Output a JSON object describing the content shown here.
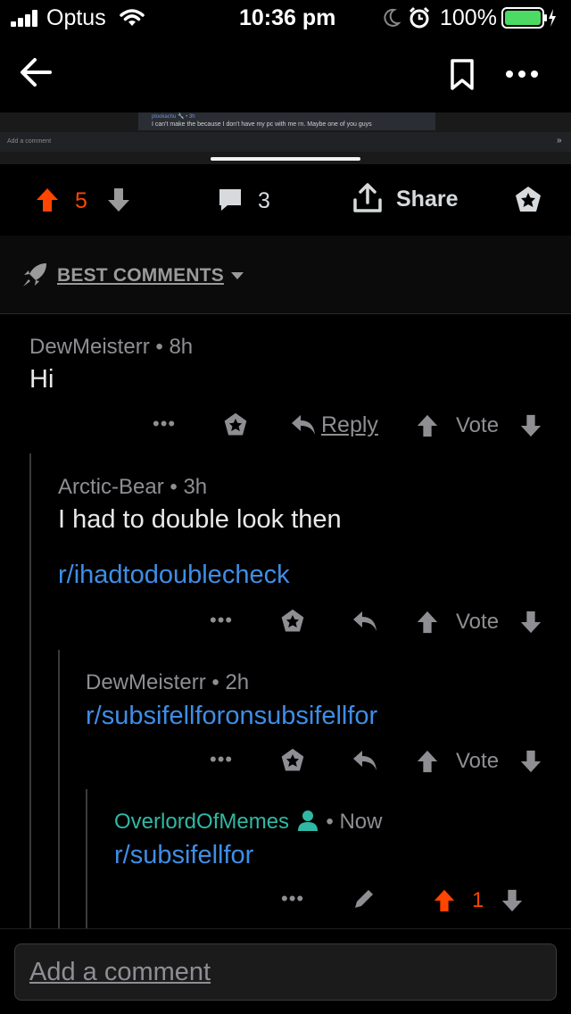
{
  "status_bar": {
    "carrier": "Optus",
    "time": "10:36 pm",
    "battery_percent": "100%"
  },
  "header": {
    "back_icon": "arrow-left-icon",
    "bookmark_icon": "bookmark-icon",
    "more_icon": "more-horizontal-icon"
  },
  "media_preview": {
    "user": "plookachu 🔧 • 3h",
    "text": "I can't make the because I don't have my pc with me rn. Maybe one of you guys",
    "add_comment": "Add a comment"
  },
  "post_actions": {
    "upvotes": "5",
    "comments": "3",
    "share_label": "Share"
  },
  "sort": {
    "label": "BEST COMMENTS"
  },
  "comments": [
    {
      "author": "DewMeisterr",
      "age": "8h",
      "body": "Hi",
      "reply_label": "Reply",
      "vote_label": "Vote"
    },
    {
      "author": "Arctic-Bear",
      "age": "3h",
      "body": "I had to double look then",
      "link": "r/ihadtodoublecheck",
      "vote_label": "Vote"
    },
    {
      "author": "DewMeisterr",
      "age": "2h",
      "link": "r/subsifellforonsubsifellfor",
      "vote_label": "Vote"
    },
    {
      "author": "OverlordOfMemes",
      "age": "Now",
      "link": "r/subsifellfor",
      "score": "1"
    }
  ],
  "comment_input": {
    "placeholder": "Add a comment"
  },
  "colors": {
    "upvote_orange": "#ff4500",
    "link_blue": "#3f8ee6",
    "op_teal": "#30b8a5",
    "battery_green": "#4cd964"
  }
}
